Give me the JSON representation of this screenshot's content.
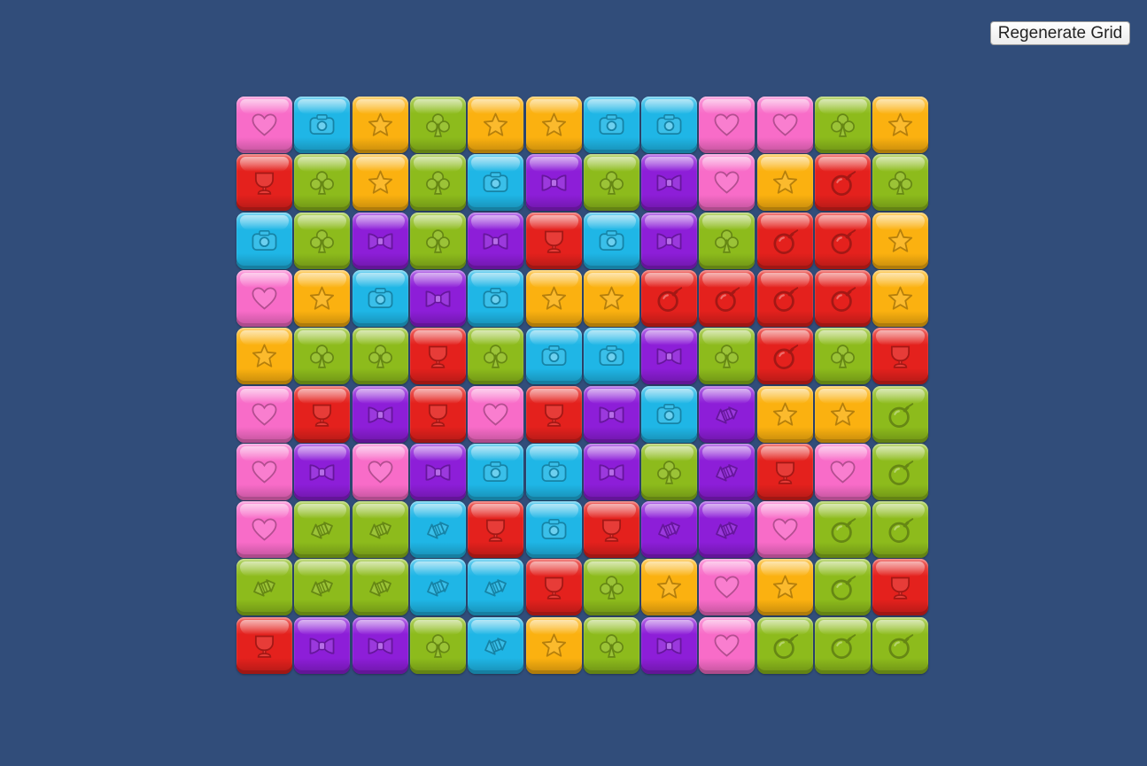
{
  "regenerate_button": {
    "label": "Regenerate Grid"
  },
  "colors": {
    "background": "#314d7a",
    "pink": "#f86cc8",
    "blue": "#1fb6e6",
    "orange": "#fbb110",
    "green": "#8dbb1c",
    "red": "#e4211d",
    "purple": "#8d1ed8"
  },
  "icon_names": {
    "P": "heart-icon",
    "B": "camera-icon",
    "O": "star-icon",
    "G": "club-icon",
    "R": "goblet-icon",
    "U": "bowtie-icon",
    "X": "bomb-icon",
    "K": "rocket-icon"
  },
  "grid": {
    "columns": 12,
    "rows": 10,
    "cells": [
      [
        "P",
        "B",
        "O",
        "G",
        "O",
        "O",
        "B",
        "B",
        "P",
        "P",
        "G",
        "O"
      ],
      [
        "R",
        "G",
        "O",
        "G",
        "B",
        "U",
        "G",
        "U",
        "P",
        "O",
        "RX",
        "G"
      ],
      [
        "B",
        "G",
        "U",
        "G",
        "U",
        "R",
        "B",
        "U",
        "G",
        "RX",
        "RX",
        "O"
      ],
      [
        "P",
        "O",
        "B",
        "U",
        "B",
        "O",
        "O",
        "RX",
        "RX",
        "RX",
        "RX",
        "O"
      ],
      [
        "O",
        "G",
        "G",
        "R",
        "G",
        "B",
        "B",
        "U",
        "G",
        "RX",
        "G",
        "R"
      ],
      [
        "P",
        "R",
        "U",
        "R",
        "P",
        "R",
        "U",
        "B",
        "UK",
        "O",
        "O",
        "GX"
      ],
      [
        "P",
        "U",
        "P",
        "U",
        "B",
        "B",
        "U",
        "G",
        "UK",
        "R",
        "P",
        "GX"
      ],
      [
        "P",
        "GK",
        "GK",
        "BK",
        "R",
        "B",
        "R",
        "UK",
        "UK",
        "P",
        "GX",
        "GX"
      ],
      [
        "GK",
        "GK",
        "GK",
        "BK",
        "BK",
        "R",
        "G",
        "O",
        "P",
        "O",
        "GX",
        "R"
      ],
      [
        "R",
        "U",
        "U",
        "G",
        "BK",
        "O",
        "G",
        "U",
        "P",
        "GX",
        "GX",
        "GX"
      ]
    ]
  }
}
